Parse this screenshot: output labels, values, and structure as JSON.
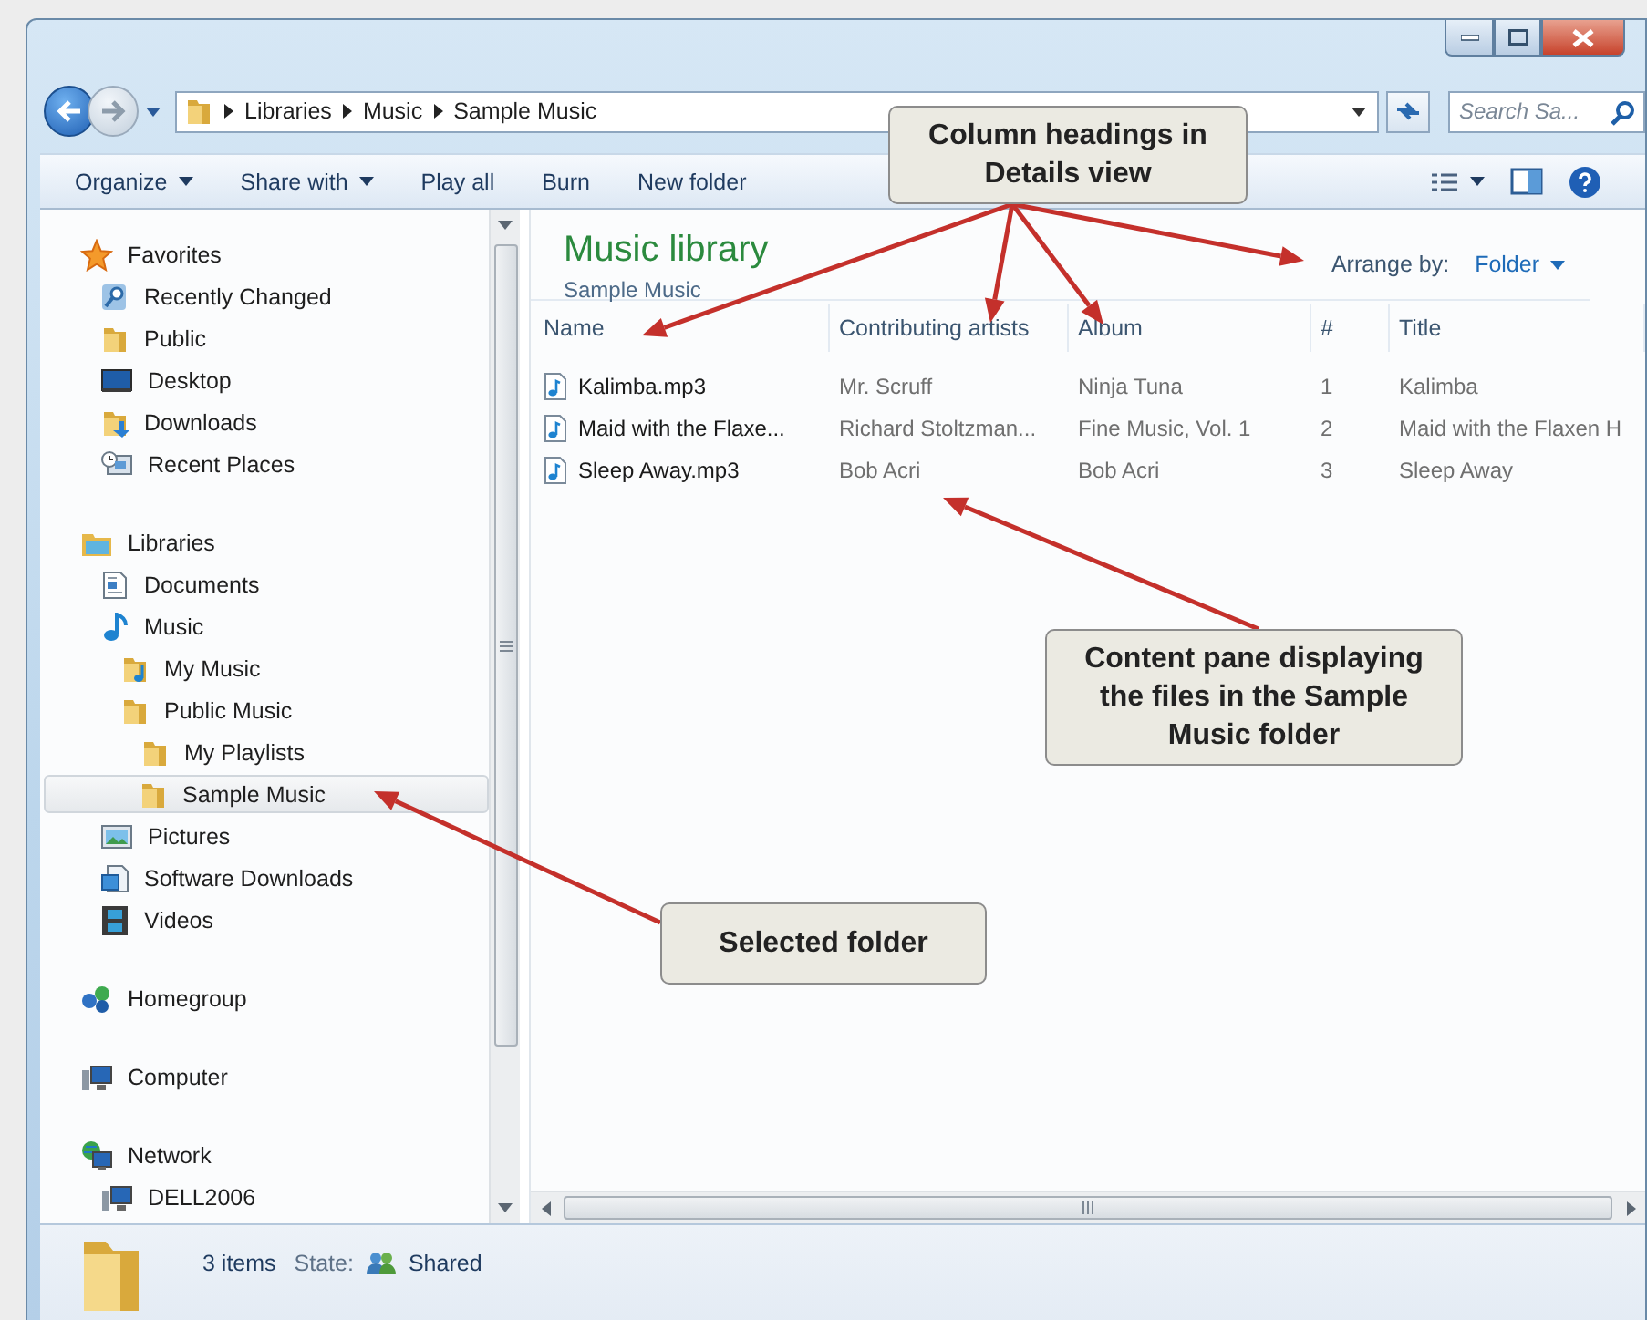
{
  "address": {
    "path": [
      "Libraries",
      "Music",
      "Sample Music"
    ]
  },
  "search": {
    "placeholder": "Search Sa..."
  },
  "toolbar": {
    "items": [
      {
        "label": "Organize",
        "menu": true
      },
      {
        "label": "Share with",
        "menu": true
      },
      {
        "label": "Play all",
        "menu": false
      },
      {
        "label": "Burn",
        "menu": false
      },
      {
        "label": "New folder",
        "menu": false
      }
    ]
  },
  "nav": {
    "items": [
      {
        "label": "Favorites",
        "kind": "star",
        "selected": false,
        "children": [
          {
            "label": "Recently Changed",
            "kind": "search",
            "selected": false
          },
          {
            "label": "Public",
            "kind": "folder",
            "selected": false
          },
          {
            "label": "Desktop",
            "kind": "desktop",
            "selected": false
          },
          {
            "label": "Downloads",
            "kind": "downloads",
            "selected": false
          },
          {
            "label": "Recent Places",
            "kind": "recent",
            "selected": false
          }
        ]
      },
      {
        "label": "Libraries",
        "kind": "library",
        "selected": false,
        "children": [
          {
            "label": "Documents",
            "kind": "documents",
            "selected": false
          },
          {
            "label": "Music",
            "kind": "music",
            "selected": false,
            "children": [
              {
                "label": "My Music",
                "kind": "music-folder",
                "selected": false
              },
              {
                "label": "Public Music",
                "kind": "folder",
                "selected": false,
                "children": [
                  {
                    "label": "My Playlists",
                    "kind": "folder",
                    "selected": false
                  },
                  {
                    "label": "Sample Music",
                    "kind": "folder",
                    "selected": true
                  }
                ]
              }
            ]
          },
          {
            "label": "Pictures",
            "kind": "pictures",
            "selected": false
          },
          {
            "label": "Software Downloads",
            "kind": "software",
            "selected": false
          },
          {
            "label": "Videos",
            "kind": "videos",
            "selected": false
          }
        ]
      },
      {
        "label": "Homegroup",
        "kind": "homegroup",
        "selected": false
      },
      {
        "label": "Computer",
        "kind": "computer",
        "selected": false
      },
      {
        "label": "Network",
        "kind": "network",
        "selected": false,
        "children": [
          {
            "label": "DELL2006",
            "kind": "computer",
            "selected": false
          }
        ]
      }
    ]
  },
  "content": {
    "title": "Music library",
    "subtitle": "Sample Music",
    "arrange_label": "Arrange by:",
    "arrange_value": "Folder",
    "columns": [
      "Name",
      "Contributing artists",
      "Album",
      "#",
      "Title"
    ],
    "rows": [
      {
        "cells": [
          "Kalimba.mp3",
          "Mr. Scruff",
          "Ninja Tuna",
          "1",
          "Kalimba"
        ]
      },
      {
        "cells": [
          "Maid with the Flaxe...",
          "Richard Stoltzman...",
          "Fine Music, Vol. 1",
          "2",
          "Maid with the Flaxen H"
        ]
      },
      {
        "cells": [
          "Sleep Away.mp3",
          "Bob Acri",
          "Bob Acri",
          "3",
          "Sleep Away"
        ]
      }
    ]
  },
  "status_bar": {
    "count": "3 items",
    "state_label": "State:",
    "state": "Shared"
  },
  "callouts": [
    {
      "text": "Column headings in Details view"
    },
    {
      "text": "Content pane displaying the files in the Sample Music folder"
    },
    {
      "text": "Selected folder"
    }
  ]
}
